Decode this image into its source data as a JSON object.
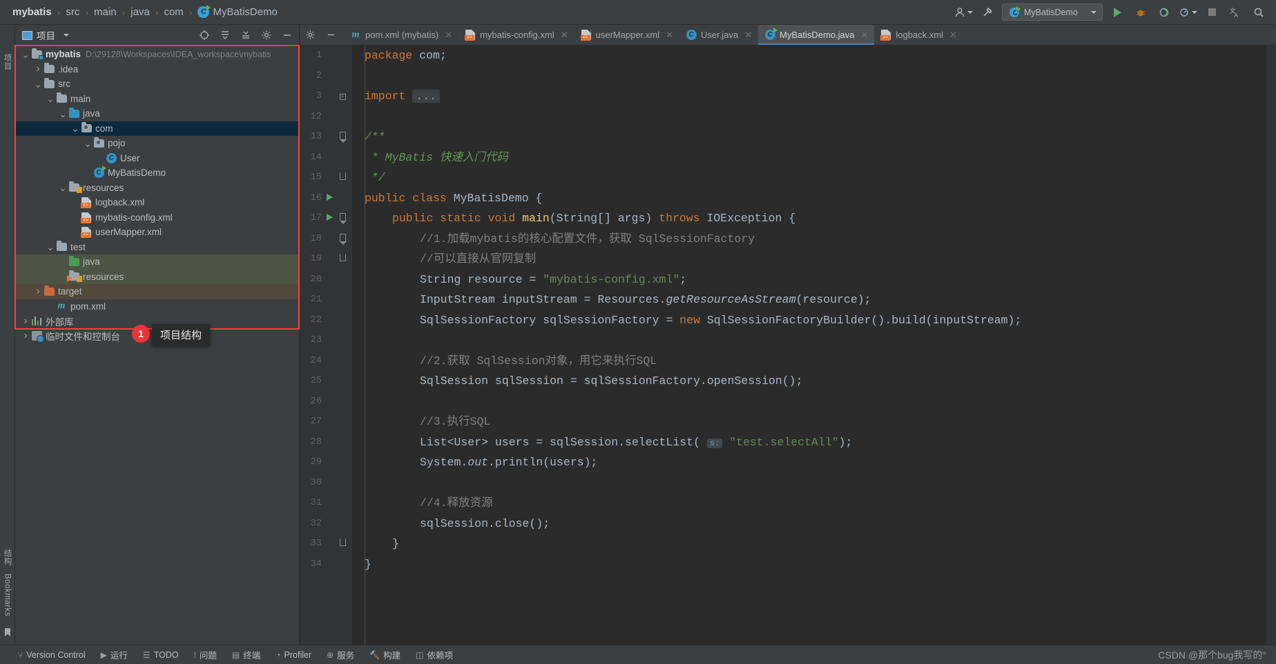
{
  "breadcrumb": {
    "items": [
      "mybatis",
      "src",
      "main",
      "java",
      "com"
    ],
    "file": "MyBatisDemo",
    "separator": "›"
  },
  "toolbar": {
    "account_icon": "user-icon",
    "build_icon": "hammer-icon",
    "run_config_label": "MyBatisDemo",
    "run_label": "run-icon",
    "debug_label": "debug-icon",
    "coverage_label": "coverage-icon",
    "profile_label": "profile-icon",
    "stop_label": "stop-icon",
    "translate_label": "translate-icon",
    "search_label": "search-icon"
  },
  "project_panel": {
    "title": "项目",
    "actions": [
      "target-icon",
      "expand-all-icon",
      "collapse-all-icon",
      "settings-icon",
      "minimize-icon"
    ],
    "tree": [
      {
        "label": "mybatis",
        "path": "D:\\29128\\Workspaces\\IDEA_workspace\\mybatis",
        "indent": 0,
        "twisty": "v",
        "icon": "module-folder",
        "bold": true,
        "state": "normal"
      },
      {
        "label": ".idea",
        "path": "",
        "indent": 1,
        "twisty": ">",
        "icon": "folder-grey",
        "bold": false,
        "state": "normal"
      },
      {
        "label": "src",
        "path": "",
        "indent": 1,
        "twisty": "v",
        "icon": "folder-grey",
        "bold": false,
        "state": "normal"
      },
      {
        "label": "main",
        "path": "",
        "indent": 2,
        "twisty": "v",
        "icon": "folder-grey",
        "bold": false,
        "state": "normal"
      },
      {
        "label": "java",
        "path": "",
        "indent": 3,
        "twisty": "v",
        "icon": "folder-sources-blue",
        "bold": false,
        "state": "normal"
      },
      {
        "label": "com",
        "path": "",
        "indent": 4,
        "twisty": "v",
        "icon": "folder-package",
        "bold": false,
        "state": "selected"
      },
      {
        "label": "pojo",
        "path": "",
        "indent": 5,
        "twisty": "v",
        "icon": "folder-package",
        "bold": false,
        "state": "normal"
      },
      {
        "label": "User",
        "path": "",
        "indent": 6,
        "twisty": "",
        "icon": "java-class",
        "bold": false,
        "state": "normal"
      },
      {
        "label": "MyBatisDemo",
        "path": "",
        "indent": 5,
        "twisty": "",
        "icon": "java-class-runnable",
        "bold": false,
        "state": "normal"
      },
      {
        "label": "resources",
        "path": "",
        "indent": 3,
        "twisty": "v",
        "icon": "folder-resources",
        "bold": false,
        "state": "normal"
      },
      {
        "label": "logback.xml",
        "path": "",
        "indent": 4,
        "twisty": "",
        "icon": "xml-file",
        "bold": false,
        "state": "normal"
      },
      {
        "label": "mybatis-config.xml",
        "path": "",
        "indent": 4,
        "twisty": "",
        "icon": "xml-file",
        "bold": false,
        "state": "normal"
      },
      {
        "label": "userMapper.xml",
        "path": "",
        "indent": 4,
        "twisty": "",
        "icon": "xml-file",
        "bold": false,
        "state": "normal"
      },
      {
        "label": "test",
        "path": "",
        "indent": 2,
        "twisty": "v",
        "icon": "folder-grey",
        "bold": false,
        "state": "normal"
      },
      {
        "label": "java",
        "path": "",
        "indent": 3,
        "twisty": "",
        "icon": "folder-test-green",
        "bold": false,
        "state": "test-source"
      },
      {
        "label": "resources",
        "path": "",
        "indent": 3,
        "twisty": "",
        "icon": "folder-test-resources",
        "bold": false,
        "state": "test-source"
      },
      {
        "label": "target",
        "path": "",
        "indent": 1,
        "twisty": ">",
        "icon": "folder-excluded-orange",
        "bold": false,
        "state": "excluded"
      },
      {
        "label": "pom.xml",
        "path": "",
        "indent": 2,
        "twisty": "",
        "icon": "maven-file",
        "bold": false,
        "state": "normal"
      },
      {
        "label": "外部库",
        "path": "",
        "indent": 0,
        "twisty": ">",
        "icon": "libraries",
        "bold": false,
        "state": "normal"
      },
      {
        "label": "临时文件和控制台",
        "path": "",
        "indent": 0,
        "twisty": ">",
        "icon": "scratches",
        "bold": false,
        "state": "normal"
      }
    ]
  },
  "annotation": {
    "badge": "1",
    "tooltip": "项目结构",
    "highlight_color": "#ff3b3b"
  },
  "left_rail": [
    "项目",
    "结构",
    "Bookmarks"
  ],
  "tabs": [
    {
      "label": "pom.xml (mybatis)",
      "icon": "maven-file",
      "active": false
    },
    {
      "label": "mybatis-config.xml",
      "icon": "xml-file",
      "active": false
    },
    {
      "label": "userMapper.xml",
      "icon": "xml-file",
      "active": false
    },
    {
      "label": "User.java",
      "icon": "java-class",
      "active": false
    },
    {
      "label": "MyBatisDemo.java",
      "icon": "java-class-runnable",
      "active": true
    },
    {
      "label": "logback.xml",
      "icon": "xml-file",
      "active": false
    }
  ],
  "editor": {
    "filename": "MyBatisDemo.java",
    "lines": [
      {
        "num": "1",
        "run": false,
        "fold": "",
        "indent": 0,
        "tokens": [
          {
            "t": "package ",
            "c": "kw"
          },
          {
            "t": "com;",
            "c": "plain"
          }
        ]
      },
      {
        "num": "2",
        "run": false,
        "fold": "",
        "indent": 0,
        "tokens": []
      },
      {
        "num": "3",
        "run": false,
        "fold": "plus",
        "indent": 0,
        "tokens": [
          {
            "t": "import ",
            "c": "kw"
          },
          {
            "t": "...",
            "c": "fold"
          }
        ]
      },
      {
        "num": "12",
        "run": false,
        "fold": "",
        "indent": 0,
        "tokens": []
      },
      {
        "num": "13",
        "run": false,
        "fold": "open",
        "indent": 0,
        "tokens": [
          {
            "t": "/**",
            "c": "jdoc"
          }
        ]
      },
      {
        "num": "14",
        "run": false,
        "fold": "",
        "indent": 0,
        "tokens": [
          {
            "t": " * MyBatis 快速入门代码",
            "c": "jdoc"
          }
        ]
      },
      {
        "num": "15",
        "run": false,
        "fold": "end",
        "indent": 0,
        "tokens": [
          {
            "t": " */",
            "c": "jdoc"
          }
        ]
      },
      {
        "num": "16",
        "run": true,
        "fold": "",
        "indent": 0,
        "tokens": [
          {
            "t": "public class ",
            "c": "kw"
          },
          {
            "t": "MyBatisDemo {",
            "c": "plain"
          }
        ]
      },
      {
        "num": "17",
        "run": true,
        "fold": "open",
        "indent": 1,
        "tokens": [
          {
            "t": "public static void ",
            "c": "kw"
          },
          {
            "t": "main",
            "c": "fn"
          },
          {
            "t": "(String[] args) ",
            "c": "plain"
          },
          {
            "t": "throws ",
            "c": "kw"
          },
          {
            "t": "IOException {",
            "c": "plain"
          }
        ]
      },
      {
        "num": "18",
        "run": false,
        "fold": "open",
        "indent": 2,
        "tokens": [
          {
            "t": "//1.加载mybatis的核心配置文件，获取 SqlSessionFactory",
            "c": "cmt"
          }
        ]
      },
      {
        "num": "19",
        "run": false,
        "fold": "end",
        "indent": 2,
        "tokens": [
          {
            "t": "//可以直接从官网复制",
            "c": "cmt"
          }
        ]
      },
      {
        "num": "20",
        "run": false,
        "fold": "",
        "indent": 2,
        "tokens": [
          {
            "t": "String resource = ",
            "c": "plain"
          },
          {
            "t": "\"mybatis-config.xml\"",
            "c": "str"
          },
          {
            "t": ";",
            "c": "plain"
          }
        ]
      },
      {
        "num": "21",
        "run": false,
        "fold": "",
        "indent": 2,
        "tokens": [
          {
            "t": "InputStream inputStream = Resources.",
            "c": "plain"
          },
          {
            "t": "getResourceAsStream",
            "c": "fnit"
          },
          {
            "t": "(resource);",
            "c": "plain"
          }
        ]
      },
      {
        "num": "22",
        "run": false,
        "fold": "",
        "indent": 2,
        "tokens": [
          {
            "t": "SqlSessionFactory sqlSessionFactory = ",
            "c": "plain"
          },
          {
            "t": "new ",
            "c": "kw"
          },
          {
            "t": "SqlSessionFactoryBuilder().build(inputStream);",
            "c": "plain"
          }
        ]
      },
      {
        "num": "23",
        "run": false,
        "fold": "",
        "indent": 0,
        "tokens": []
      },
      {
        "num": "24",
        "run": false,
        "fold": "",
        "indent": 2,
        "tokens": [
          {
            "t": "//2.获取 SqlSession对象，用它来执行SQL",
            "c": "cmt"
          }
        ]
      },
      {
        "num": "25",
        "run": false,
        "fold": "",
        "indent": 2,
        "tokens": [
          {
            "t": "SqlSession sqlSession = sqlSessionFactory.openSession();",
            "c": "plain"
          }
        ]
      },
      {
        "num": "26",
        "run": false,
        "fold": "",
        "indent": 0,
        "tokens": []
      },
      {
        "num": "27",
        "run": false,
        "fold": "",
        "indent": 2,
        "tokens": [
          {
            "t": "//3.执行SQL",
            "c": "cmt"
          }
        ]
      },
      {
        "num": "28",
        "run": false,
        "fold": "",
        "indent": 2,
        "tokens": [
          {
            "t": "List<User> users = sqlSession.selectList( ",
            "c": "plain"
          },
          {
            "t": "s:",
            "c": "hint"
          },
          {
            "t": " ",
            "c": "plain"
          },
          {
            "t": "\"test.selectAll\"",
            "c": "str"
          },
          {
            "t": ");",
            "c": "plain"
          }
        ]
      },
      {
        "num": "29",
        "run": false,
        "fold": "",
        "indent": 2,
        "tokens": [
          {
            "t": "System.",
            "c": "plain"
          },
          {
            "t": "out",
            "c": "fnit"
          },
          {
            "t": ".println(users);",
            "c": "plain"
          }
        ]
      },
      {
        "num": "30",
        "run": false,
        "fold": "",
        "indent": 0,
        "tokens": []
      },
      {
        "num": "31",
        "run": false,
        "fold": "",
        "indent": 2,
        "tokens": [
          {
            "t": "//4.释放资源",
            "c": "cmt"
          }
        ]
      },
      {
        "num": "32",
        "run": false,
        "fold": "",
        "indent": 2,
        "tokens": [
          {
            "t": "sqlSession.close();",
            "c": "plain"
          }
        ]
      },
      {
        "num": "33",
        "run": false,
        "fold": "end",
        "indent": 1,
        "tokens": [
          {
            "t": "}",
            "c": "plain"
          }
        ]
      },
      {
        "num": "34",
        "run": false,
        "fold": "",
        "indent": 0,
        "tokens": [
          {
            "t": "}",
            "c": "plain"
          }
        ]
      }
    ]
  },
  "status_bar": {
    "items": [
      {
        "label": "Version Control",
        "icon": "branch-icon"
      },
      {
        "label": "运行",
        "icon": "run-icon"
      },
      {
        "label": "TODO",
        "icon": "todo-icon"
      },
      {
        "label": "问题",
        "icon": "problems-icon"
      },
      {
        "label": "终端",
        "icon": "terminal-icon"
      },
      {
        "label": "Profiler",
        "icon": "profiler-icon"
      },
      {
        "label": "服务",
        "icon": "services-icon"
      },
      {
        "label": "构建",
        "icon": "build-icon"
      },
      {
        "label": "依赖项",
        "icon": "dependencies-icon"
      }
    ],
    "watermark": "CSDN @那个bug我写的°"
  }
}
